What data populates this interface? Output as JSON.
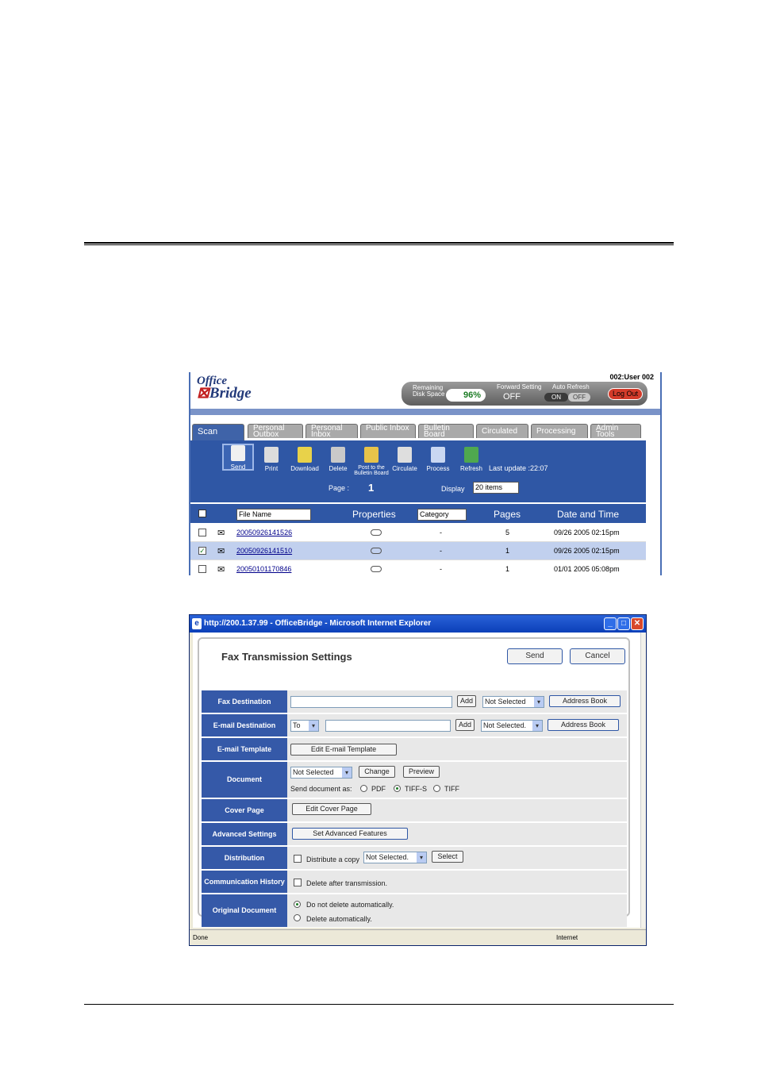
{
  "scan_ui": {
    "logo": {
      "line1": "Office",
      "line2": "Bridge"
    },
    "user": "002:User 002",
    "remaining_disk_label": "Remaining Disk Space",
    "remaining_disk_value": "96%",
    "forward_setting_label": "Forward Setting",
    "forward_setting_value": "OFF",
    "auto_refresh_label": "Auto Refresh",
    "auto_refresh_on": "ON",
    "auto_refresh_off": "OFF",
    "logout": "Log Out",
    "tabs": [
      "Scan",
      "Personal Outbox",
      "Personal Inbox",
      "Public Inbox",
      "Bulletin Board",
      "Circulated",
      "Processing",
      "Admin Tools"
    ],
    "toolbar": [
      "Send",
      "Print",
      "Download",
      "Delete",
      "Post to the Bulletin Board",
      "Circulate",
      "Process",
      "Refresh"
    ],
    "last_update": "Last update :22:07",
    "page_label": "Page :",
    "page_value": "1",
    "display_label": "Display",
    "display_value": "20 items",
    "columns": {
      "file": "File Name",
      "properties": "Properties",
      "category": "Category",
      "pages": "Pages",
      "datetime": "Date and Time"
    },
    "rows": [
      {
        "name": "20050926141526",
        "category": "-",
        "pages": "5",
        "datetime": "09/26 2005 02:15pm",
        "checked": ""
      },
      {
        "name": "20050926141510",
        "category": "-",
        "pages": "1",
        "datetime": "09/26 2005 02:15pm",
        "checked": "✓"
      },
      {
        "name": "20050101170846",
        "category": "-",
        "pages": "1",
        "datetime": "01/01 2005 05:08pm",
        "checked": ""
      }
    ]
  },
  "fax_window": {
    "title": "http://200.1.37.99 - OfficeBridge - Microsoft Internet Explorer",
    "heading": "Fax Transmission Settings",
    "send": "Send",
    "cancel": "Cancel",
    "labels": {
      "fax_dest": "Fax Destination",
      "email_dest": "E-mail Destination",
      "email_tmpl": "E-mail Template",
      "document": "Document",
      "cover": "Cover Page",
      "advanced": "Advanced Settings",
      "distribution": "Distribution",
      "comm_history": "Communication History",
      "original": "Original Document"
    },
    "add": "Add",
    "not_selected": "Not Selected",
    "not_selected_dot": "Not Selected.",
    "address_book": "Address Book",
    "to": "To",
    "edit_email_template": "Edit E-mail Template",
    "change": "Change",
    "preview": "Preview",
    "send_doc_as": "Send document as:",
    "pdf": "PDF",
    "tiff_s": "TIFF-S",
    "tiff": "TIFF",
    "edit_cover_page": "Edit Cover Page",
    "set_advanced": "Set Advanced Features",
    "distribute_copy": "Distribute a copy",
    "select": "Select",
    "delete_after": "Delete after transmission.",
    "do_not_delete": "Do not delete automatically.",
    "delete_auto": "Delete automatically.",
    "status_done": "Done",
    "status_zone": "Internet"
  }
}
